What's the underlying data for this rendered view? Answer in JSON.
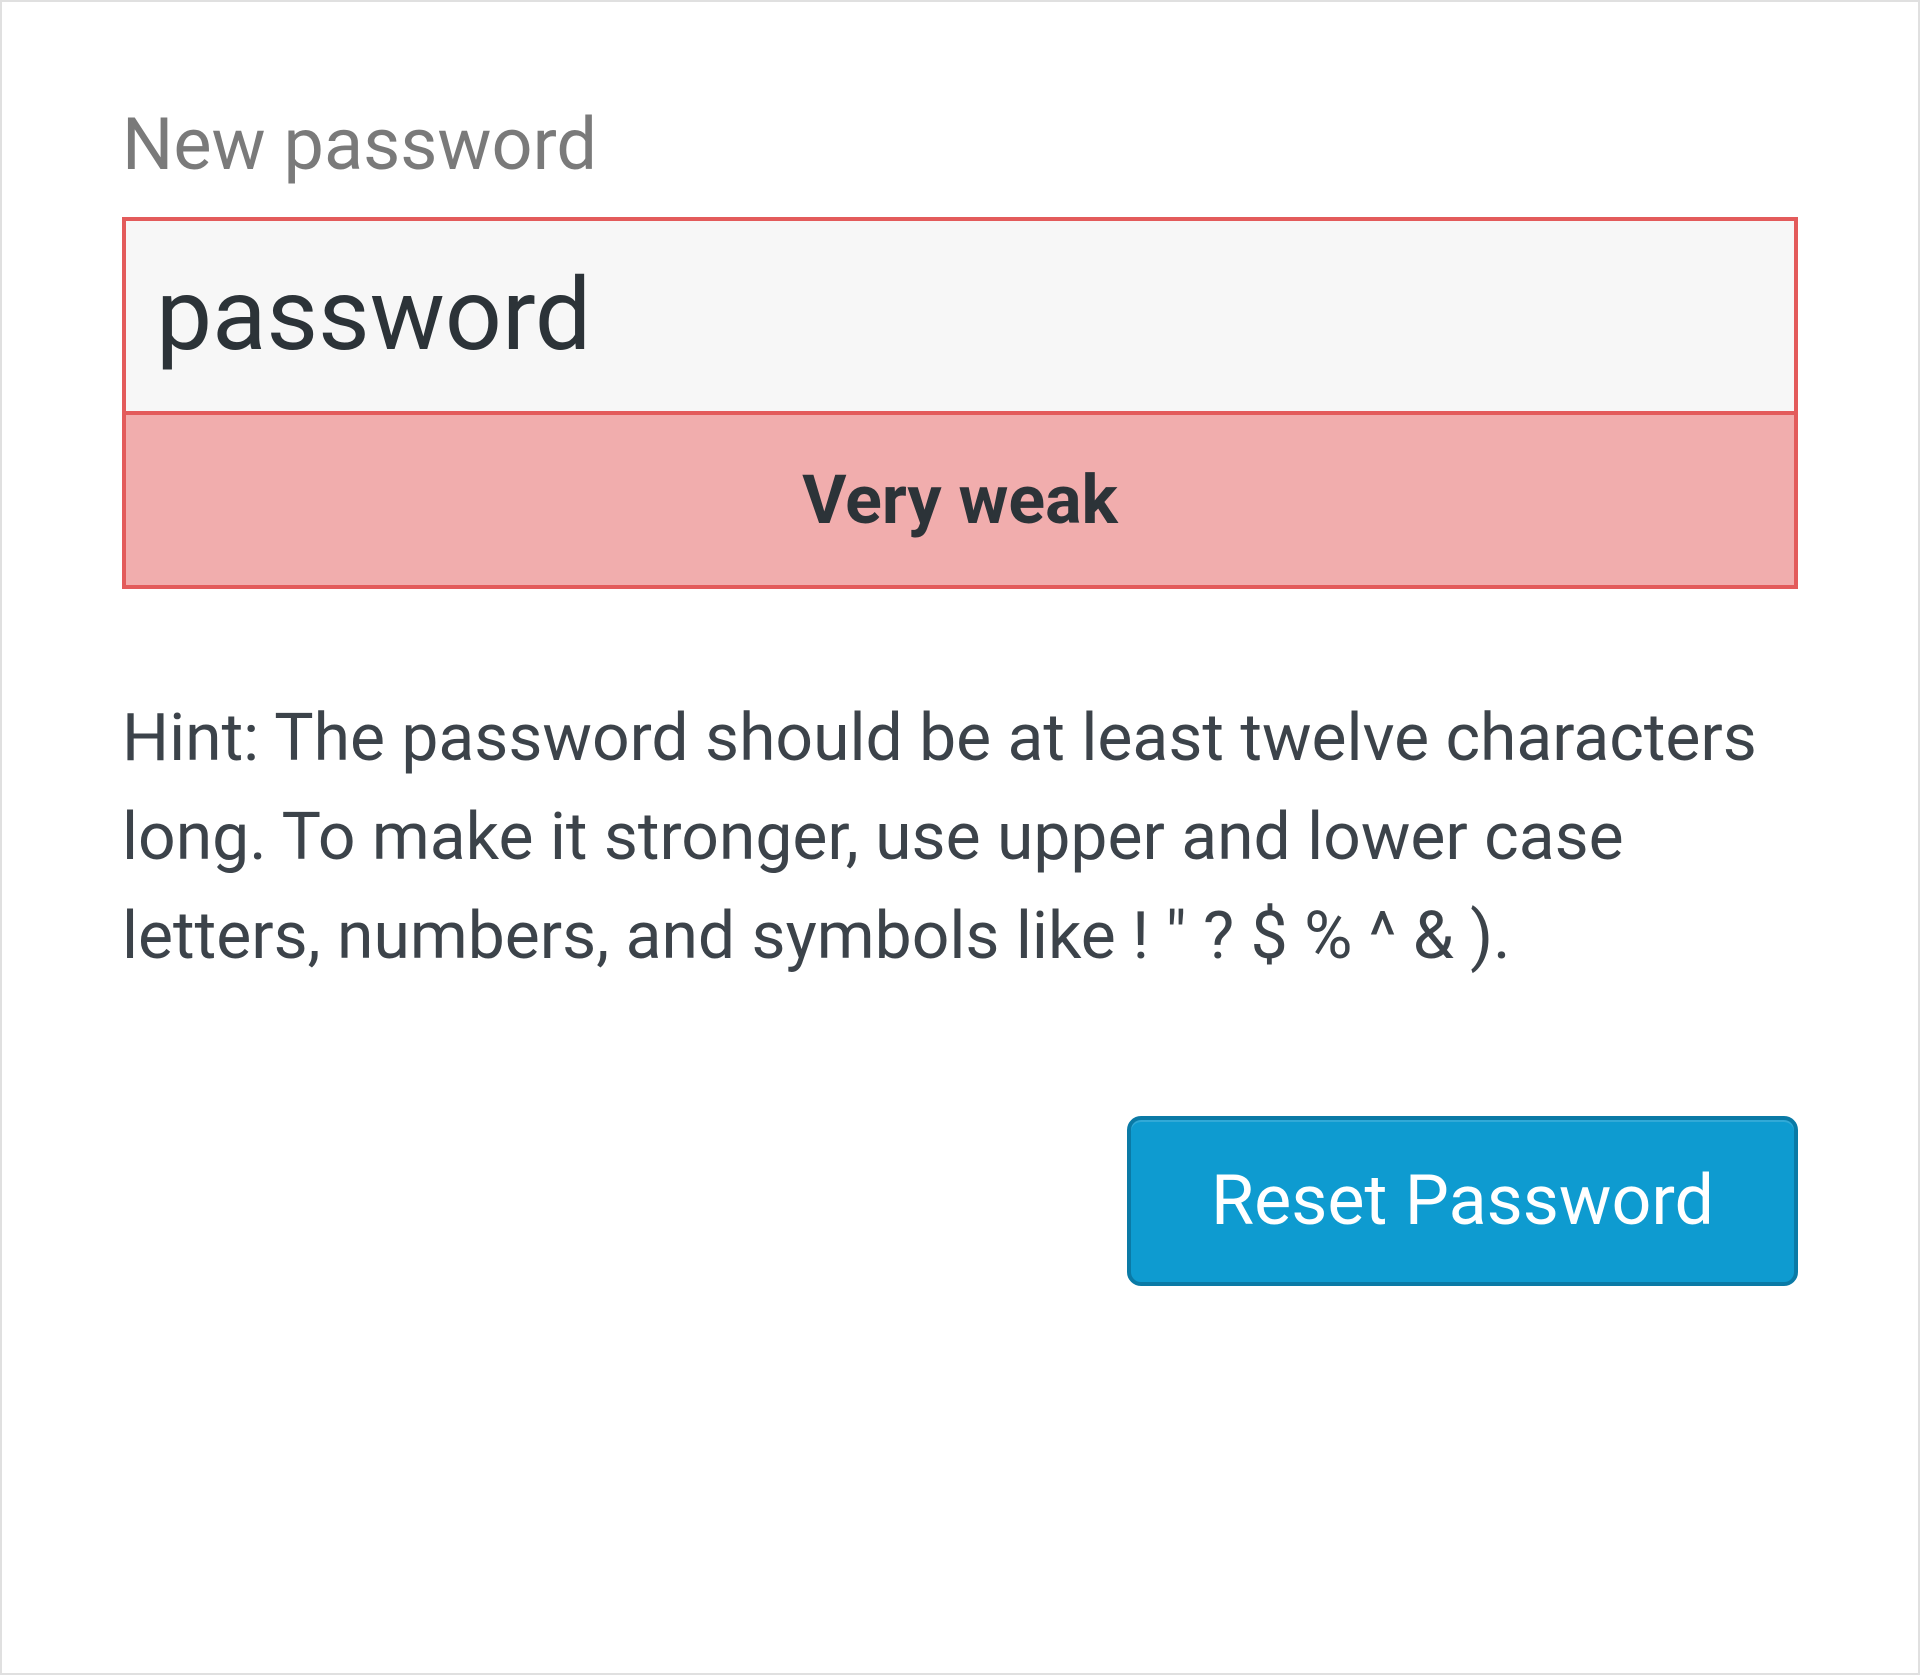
{
  "form": {
    "label": "New password",
    "input_value": "password",
    "strength_label": "Very weak",
    "hint_text": "Hint: The password should be at least twelve characters long. To make it stronger, use upper and lower case letters, numbers, and symbols like ! \" ? $ % ^ & ).",
    "submit_label": "Reset Password"
  },
  "colors": {
    "strength_border": "#e35b5b",
    "strength_bg": "#f1adad",
    "button_bg": "#0e9bd0",
    "button_border": "#0a7aa6"
  }
}
